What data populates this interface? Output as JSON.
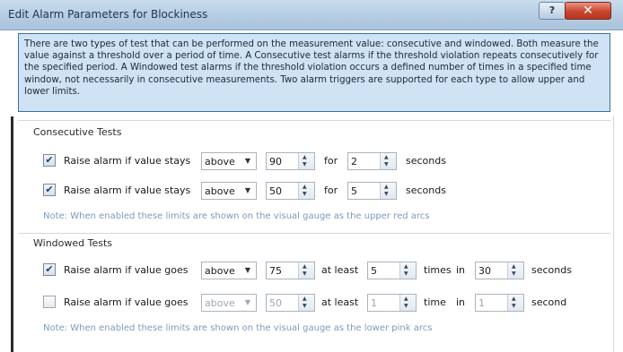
{
  "window": {
    "title": "Edit Alarm Parameters for Blockiness",
    "help_label": "?",
    "close_label": "✕"
  },
  "description": "There are two types of test that can be performed on the measurement value: consecutive and windowed. Both measure the value against a threshold over a period of time. A Consecutive test alarms if the threshold violation repeats consecutively for the specified period. A Windowed test alarms if the threshold violation occurs a defined number of times in a specified time window, not necessarily in consecutive measurements. Two alarm triggers are supported for each type to allow upper and lower limits.",
  "consecutive": {
    "title": "Consecutive Tests",
    "rows": [
      {
        "checked": true,
        "label": "Raise alarm if value stays",
        "direction": "above",
        "threshold": "90",
        "for_label": "for",
        "period": "2",
        "unit": "seconds"
      },
      {
        "checked": true,
        "label": "Raise alarm if value stays",
        "direction": "above",
        "threshold": "50",
        "for_label": "for",
        "period": "5",
        "unit": "seconds"
      }
    ],
    "note": "Note: When enabled these limits are shown on the visual gauge as the upper red arcs"
  },
  "windowed": {
    "title": "Windowed Tests",
    "rows": [
      {
        "checked": true,
        "label": "Raise alarm if value goes",
        "direction": "above",
        "threshold": "75",
        "atleast_label": "at least",
        "count": "5",
        "times_label": "times",
        "in_label": "in",
        "window": "30",
        "unit": "seconds"
      },
      {
        "checked": false,
        "label": "Raise alarm if value goes",
        "direction": "above",
        "threshold": "50",
        "atleast_label": "at least",
        "count": "1",
        "times_label": "time",
        "in_label": "in",
        "window": "1",
        "unit": "second"
      }
    ],
    "note": "Note: When enabled these limits are shown on the visual gauge as the lower pink arcs"
  },
  "icons": {
    "check": "✔",
    "dropdown": "▼",
    "spin_up": "▲",
    "spin_down": "▼"
  }
}
